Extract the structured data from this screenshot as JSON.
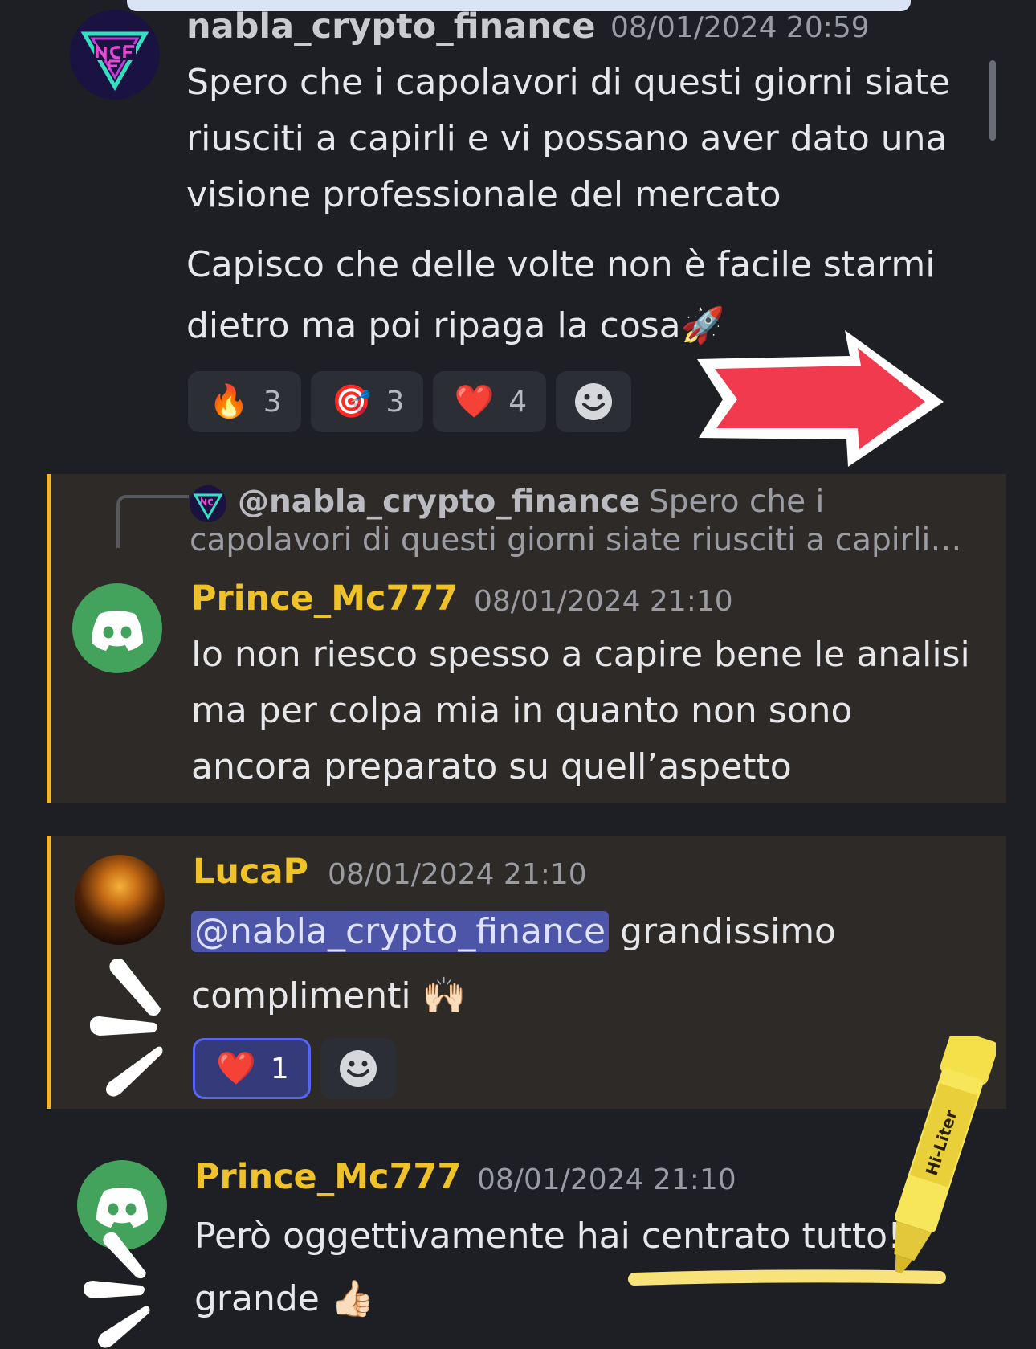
{
  "messages": [
    {
      "author": "nabla_crypto_finance",
      "timestamp": "08/01/2024 20:59",
      "lines": [
        "Spero che i capolavori di questi giorni siate",
        "riusciti a capirli e vi possano aver dato una",
        "visione professionale del mercato"
      ],
      "lines2": [
        "Capisco che delle volte non è facile starmi",
        "dietro ma poi ripaga la cosa🚀"
      ],
      "reactions": [
        {
          "emoji": "🔥",
          "count": "3"
        },
        {
          "emoji": "🎯",
          "count": "3"
        },
        {
          "emoji": "❤️",
          "count": "4"
        }
      ]
    },
    {
      "reply_to": {
        "author": "@nabla_crypto_finance",
        "preview_1": "Spero che i",
        "preview_2": "capolavori di questi giorni siate riusciti a capirli…"
      },
      "author": "Prince_Mc777",
      "timestamp": "08/01/2024 21:10",
      "lines": [
        "Io non riesco spesso a capire bene le analisi",
        "ma per colpa mia in quanto non sono",
        "ancora preparato su quell’aspetto"
      ]
    },
    {
      "author": "LucaP",
      "timestamp": "08/01/2024 21:10",
      "mention": "@nabla_crypto_finance",
      "line1_rest": " grandissimo",
      "line2": "complimenti 🙌🏻",
      "reactions": [
        {
          "emoji": "❤️",
          "count": "1"
        }
      ]
    },
    {
      "author": "Prince_Mc777",
      "timestamp": "08/01/2024 21:10",
      "lines": [
        "Però oggettivamente hai centrato tutto!",
        "grande 👍🏻"
      ]
    }
  ],
  "highlighter_brand": "Hi-Liter",
  "colors": {
    "background": "#1e1f24",
    "highlighted_message": "#2d2a27",
    "mention_bar": "#f0b232",
    "username_gold": "#f0c229",
    "discord_green": "#43a35d",
    "blurple": "#5865f2",
    "arrow_red": "#f23a4e"
  },
  "icons": [
    "ncf-logo",
    "discord-logo-icon",
    "smiley-add-reaction-icon",
    "red-arrow-sticker",
    "sparkle-lines-sticker",
    "highlighter-sticker"
  ]
}
